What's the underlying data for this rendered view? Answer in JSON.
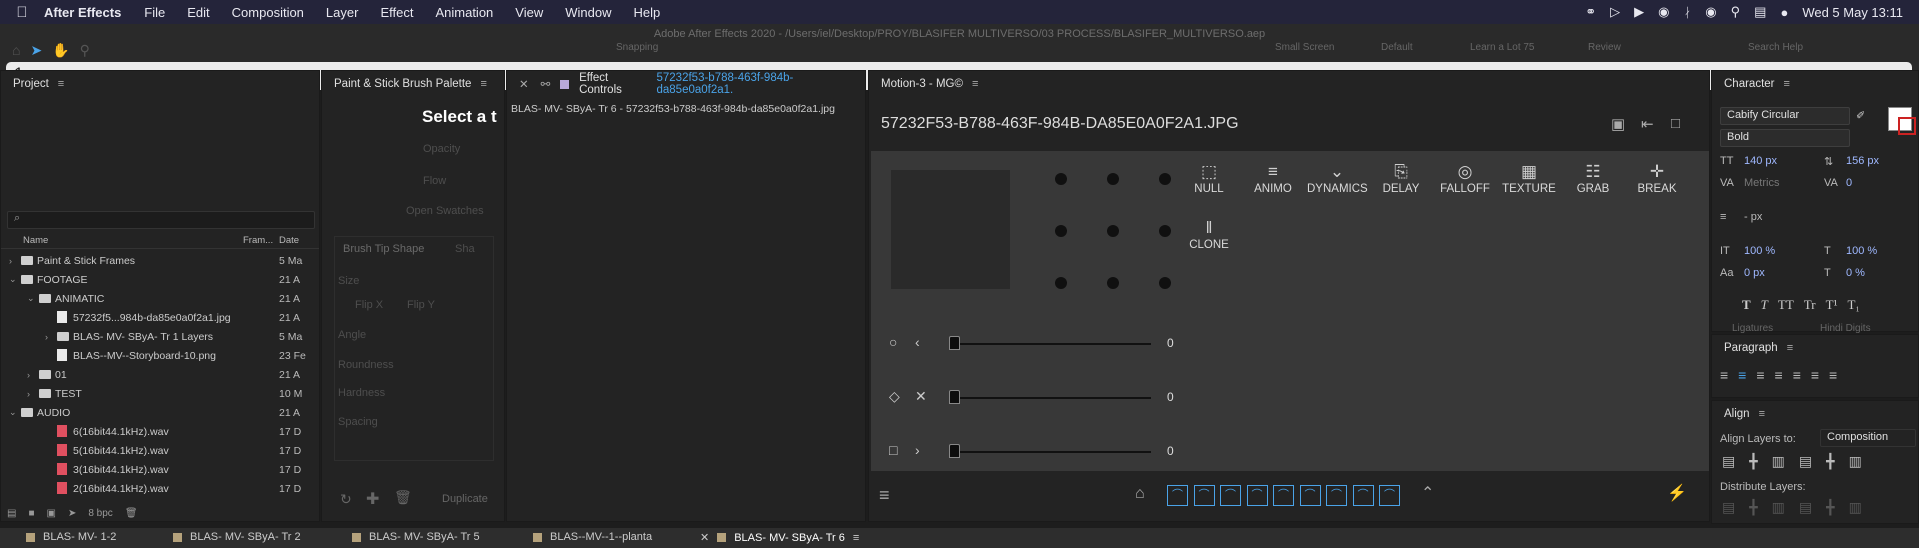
{
  "menubar": {
    "app": "After Effects",
    "items": [
      "File",
      "Edit",
      "Composition",
      "Layer",
      "Effect",
      "Animation",
      "View",
      "Window",
      "Help"
    ],
    "clock": "Wed 5 May  13:11"
  },
  "window": {
    "title": "Adobe After Effects 2020 - /Users/iel/Desktop/PROY/BLASIFER MULTIVERSO/03 PROCESS/BLASIFER_MULTIVERSO.aep"
  },
  "toolbar": {
    "snapping": "Snapping",
    "workspaces": [
      "Small Screen",
      "Default",
      "Learn a Lot 75",
      "Review"
    ],
    "search_help": "Search Help",
    "command_input": "1"
  },
  "project": {
    "title": "Project",
    "search_placeholder": "⌕",
    "columns": [
      "Name",
      "Fram...",
      "Date"
    ],
    "rows": [
      {
        "name": "Paint & Stick Frames",
        "date": "5 Ma",
        "type": "folder",
        "indent": 0,
        "twirl": "›"
      },
      {
        "name": "FOOTAGE",
        "date": "21 A",
        "type": "folder",
        "indent": 0,
        "twirl": "⌄"
      },
      {
        "name": "ANIMATIC",
        "date": "21 A",
        "type": "folder",
        "indent": 1,
        "twirl": "⌄"
      },
      {
        "name": "57232f5...984b-da85e0a0f2a1.jpg",
        "date": "21 A",
        "type": "file",
        "indent": 2,
        "twirl": ""
      },
      {
        "name": "BLAS- MV- SByA- Tr 1 Layers",
        "date": "5 Ma",
        "type": "folder",
        "indent": 2,
        "twirl": "›"
      },
      {
        "name": "BLAS--MV--Storyboard-10.png",
        "date": "23 Fe",
        "type": "file",
        "indent": 2,
        "twirl": ""
      },
      {
        "name": "01",
        "date": "21 A",
        "type": "folder",
        "indent": 1,
        "twirl": "›"
      },
      {
        "name": "TEST",
        "date": "10 M",
        "type": "folder",
        "indent": 1,
        "twirl": "›"
      },
      {
        "name": "AUDIO",
        "date": "21 A",
        "type": "folder",
        "indent": 0,
        "twirl": "⌄"
      },
      {
        "name": "6(16bit44.1kHz).wav",
        "date": "17 D",
        "type": "wav",
        "indent": 2,
        "twirl": ""
      },
      {
        "name": "5(16bit44.1kHz).wav",
        "date": "17 D",
        "type": "wav",
        "indent": 2,
        "twirl": ""
      },
      {
        "name": "3(16bit44.1kHz).wav",
        "date": "17 D",
        "type": "wav",
        "indent": 2,
        "twirl": ""
      },
      {
        "name": "2(16bit44.1kHz).wav",
        "date": "17 D",
        "type": "wav",
        "indent": 2,
        "twirl": ""
      }
    ],
    "bpc": "8 bpc"
  },
  "paint": {
    "title": "Paint & Stick Brush Palette",
    "heading": "Select a t",
    "opacity": "Opacity",
    "flow": "Flow",
    "open_swatches": "Open Swatches",
    "brush_tip_shape": "Brush Tip Shape",
    "sha": "Sha",
    "size": "Size",
    "flip_x": "Flip X",
    "flip_y": "Flip Y",
    "angle": "Angle",
    "roundness": "Roundness",
    "hardness": "Hardness",
    "spacing": "Spacing",
    "duplicate": "Duplicate"
  },
  "effect_controls": {
    "title": "Effect Controls",
    "target": "57232f53-b788-463f-984b-da85e0a0f2a1.",
    "layer_path": "BLAS- MV- SByA- Tr 6 - 57232f53-b788-463f-984b-da85e0a0f2a1.jpg"
  },
  "motion": {
    "title": "Motion-3 - MG©",
    "filename": "57232F53-B788-463F-984B-DA85E0A0F2A1.JPG",
    "buttons": [
      {
        "label": "NULL",
        "icon": "null-icon",
        "glyph": "⬚"
      },
      {
        "label": "ANIMO",
        "icon": "animo-icon",
        "glyph": "≡"
      },
      {
        "label": "DYNAMICS",
        "icon": "dynamics-icon",
        "glyph": "⌄"
      },
      {
        "label": "DELAY",
        "icon": "delay-icon",
        "glyph": "⎘"
      },
      {
        "label": "FALLOFF",
        "icon": "falloff-icon",
        "glyph": "◎"
      },
      {
        "label": "TEXTURE",
        "icon": "texture-icon",
        "glyph": "▦"
      },
      {
        "label": "GRAB",
        "icon": "grab-icon",
        "glyph": "☷"
      },
      {
        "label": "BREAK",
        "icon": "break-icon",
        "glyph": "✛"
      },
      {
        "label": "CLONE",
        "icon": "clone-icon",
        "glyph": "‖"
      }
    ],
    "sliders": [
      {
        "shape": "○",
        "arrow": "‹",
        "value": "0"
      },
      {
        "shape": "◇",
        "arrow": "✕",
        "value": "0"
      },
      {
        "shape": "□",
        "arrow": "›",
        "value": "0"
      }
    ]
  },
  "character": {
    "title": "Character",
    "font": "Cabify Circular",
    "style": "Bold",
    "size": "140 px",
    "leading": "156 px",
    "kerning": "Metrics",
    "tracking": "0",
    "stroke": "- px",
    "vscale": "100 %",
    "hscale": "100 %",
    "baseline": "0 px",
    "tsume": "0 %",
    "typo_buttons": [
      "T",
      "T",
      "TT",
      "Tr",
      "T¹",
      "T₁"
    ],
    "ligatures": "Ligatures",
    "hindi": "Hindi Digits"
  },
  "paragraph": {
    "title": "Paragraph"
  },
  "align": {
    "title": "Align",
    "align_to_label": "Align Layers to:",
    "align_to_value": "Composition",
    "distribute": "Distribute Layers:"
  },
  "timeline_tabs": [
    {
      "label": "BLAS- MV- 1-2",
      "active": false
    },
    {
      "label": "BLAS- MV- SByA- Tr 2",
      "active": false
    },
    {
      "label": "BLAS- MV- SByA- Tr 5",
      "active": false
    },
    {
      "label": "BLAS--MV--1--planta",
      "active": false
    },
    {
      "label": "BLAS- MV- SByA- Tr 6",
      "active": true
    }
  ],
  "colors": {
    "accent": "#4aa3e8",
    "menubar": "#24243a",
    "panel": "#232323",
    "motion_bg": "#383838"
  }
}
